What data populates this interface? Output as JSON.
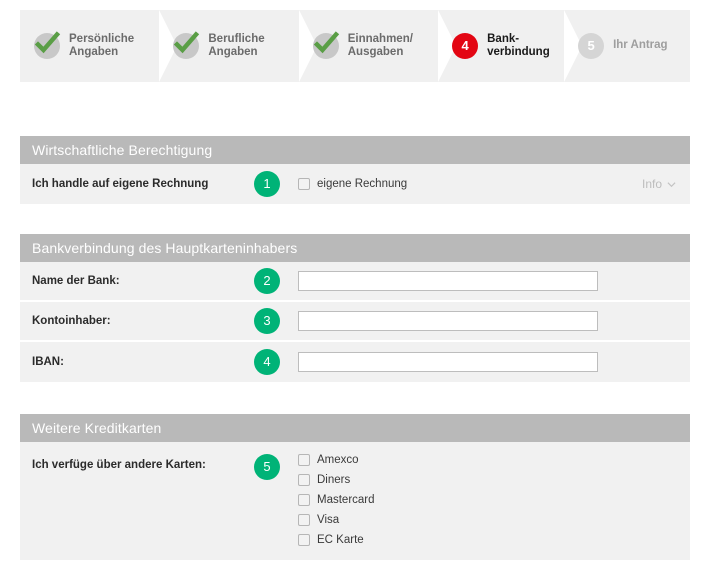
{
  "wizard": {
    "steps": [
      {
        "num": "1",
        "label": "Persönliche\nAngaben",
        "state": "done",
        "icon": "check-icon"
      },
      {
        "num": "2",
        "label": "Berufliche\nAngaben",
        "state": "done",
        "icon": "check-icon"
      },
      {
        "num": "3",
        "label": "Einnahmen/\nAusgaben",
        "state": "done",
        "icon": "check-icon"
      },
      {
        "num": "4",
        "label": "Bank-\nverbindung",
        "state": "active",
        "icon": "number-badge"
      },
      {
        "num": "5",
        "label": "Ihr Antrag",
        "state": "pending",
        "icon": "number-badge"
      }
    ],
    "colors": {
      "done": "#c8c8c8",
      "check": "#5a9e46",
      "active": "#e30613",
      "pending": "#d5d5d5",
      "bar": "#f0f0f0"
    }
  },
  "sections": {
    "beneficial": {
      "header": "Wirtschaftliche Berechtigung",
      "row": {
        "label": "Ich handle auf eigene Rechnung",
        "badge": "1",
        "checkbox_label": "eigene Rechnung",
        "checked": false,
        "info_label": "Info",
        "info_icon": "chevron-down-icon"
      }
    },
    "bank": {
      "header": "Bankverbindung des Hauptkarteninhabers",
      "rows": [
        {
          "label": "Name der Bank:",
          "badge": "2",
          "value": "",
          "placeholder": ""
        },
        {
          "label": "Kontoinhaber:",
          "badge": "3",
          "value": "",
          "placeholder": ""
        },
        {
          "label": "IBAN:",
          "badge": "4",
          "value": "",
          "placeholder": ""
        }
      ]
    },
    "cards": {
      "header": "Weitere Kreditkarten",
      "row": {
        "label": "Ich verfüge über andere Karten:",
        "badge": "5",
        "options": [
          {
            "label": "Amexco",
            "checked": false
          },
          {
            "label": "Diners",
            "checked": false
          },
          {
            "label": "Mastercard",
            "checked": false
          },
          {
            "label": "Visa",
            "checked": false
          },
          {
            "label": "EC Karte",
            "checked": false
          }
        ]
      }
    }
  },
  "theme": {
    "accent_green": "#00b377",
    "header_gray": "#b9b9b9",
    "row_gray": "#f1f1f1",
    "active_red": "#e30613"
  }
}
